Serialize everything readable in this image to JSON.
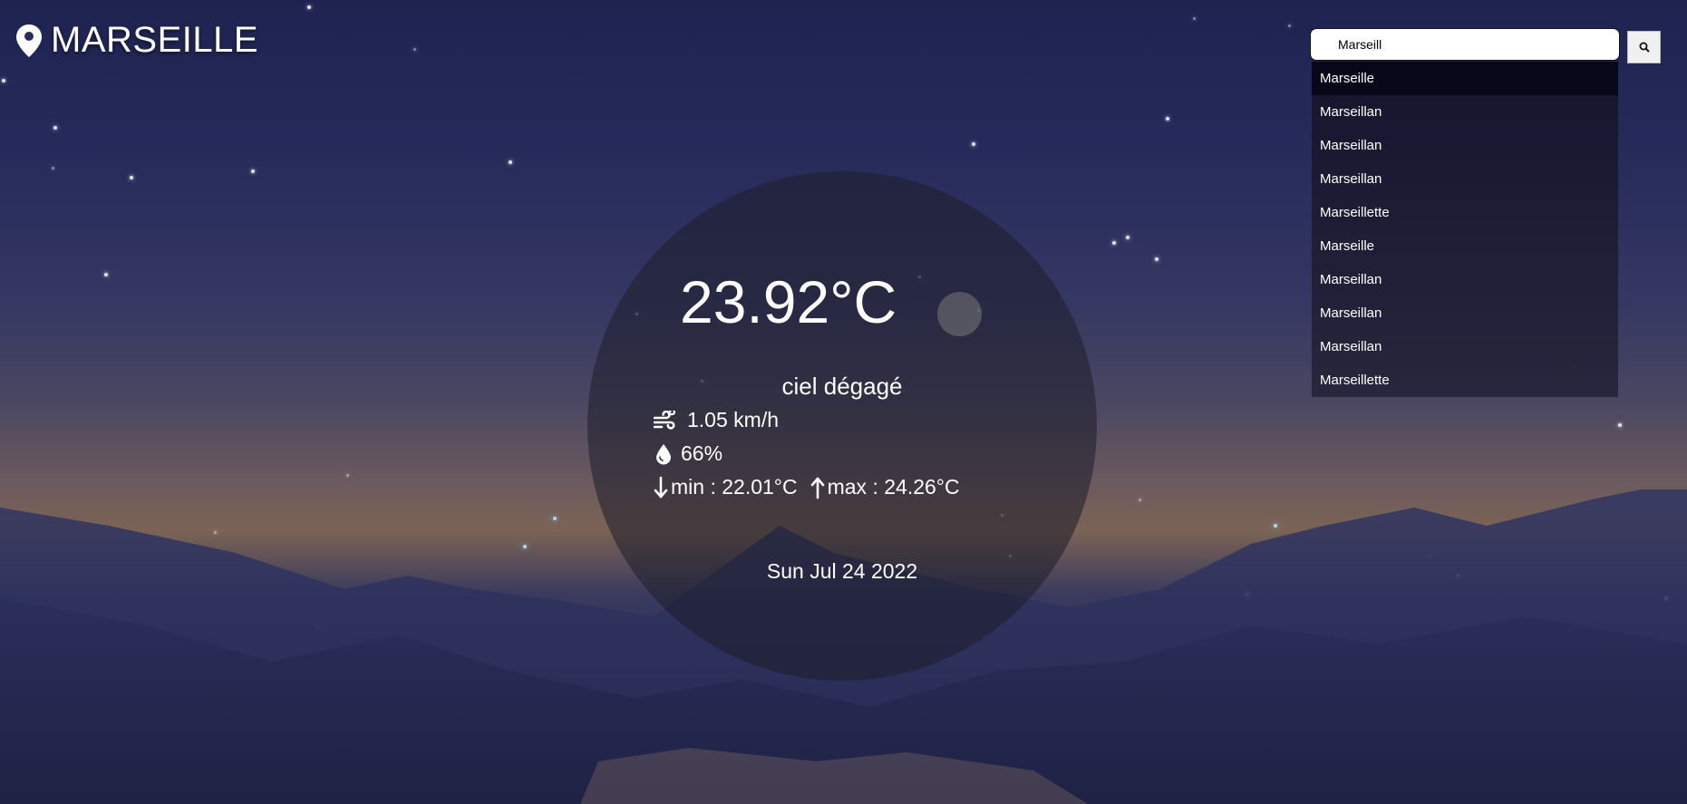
{
  "header": {
    "city_name": "MARSEILLE",
    "pin_icon": "map-pin-icon"
  },
  "search": {
    "value": "Marseill",
    "placeholder": "",
    "button_icon": "search-icon",
    "suggestions": [
      "Marseille",
      "Marseillan",
      "Marseillan",
      "Marseillan",
      "Marseillette",
      "Marseille",
      "Marseillan",
      "Marseillan",
      "Marseillan",
      "Marseillette"
    ]
  },
  "weather": {
    "temperature": "23.92°C",
    "description": "ciel dégagé",
    "wind": "1.05 km/h",
    "humidity": "66%",
    "min": "min : 22.01°C",
    "max": "max : 24.26°C",
    "date": "Sun Jul 24 2022",
    "wind_icon": "wind-icon",
    "humidity_icon": "droplet-icon",
    "min_icon": "arrow-down-icon",
    "max_icon": "arrow-up-icon"
  }
}
